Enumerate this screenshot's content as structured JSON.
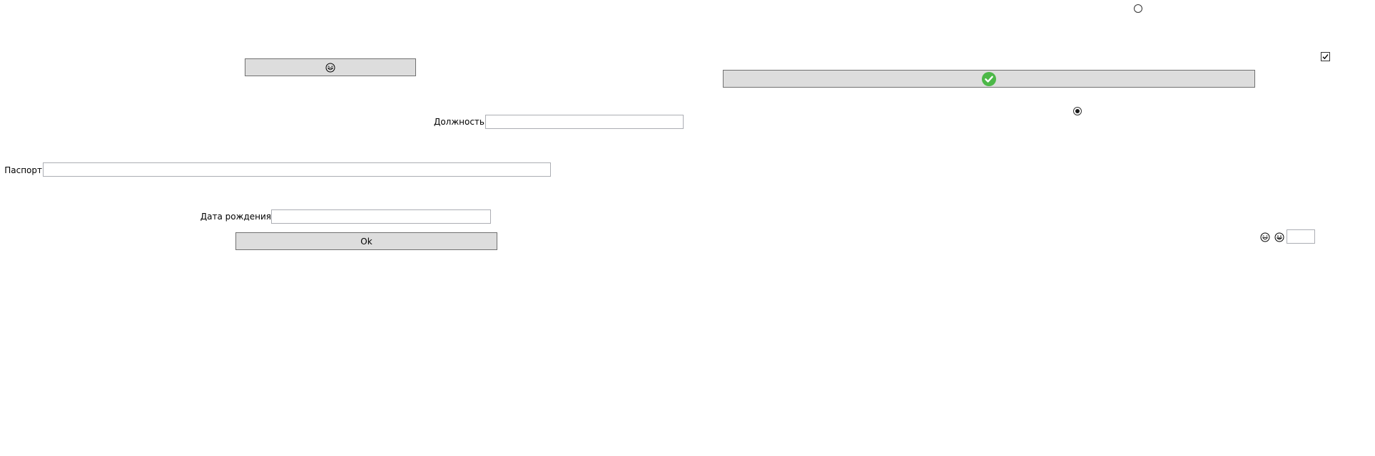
{
  "form": {
    "position_label": "Должность",
    "position_value": "",
    "passport_label": "Паспорт",
    "passport_value": "",
    "birthdate_label": "Дата рождения",
    "birthdate_value": "",
    "ok_label": "Ok",
    "small_input_value": ""
  },
  "controls": {
    "top_radio_checked": false,
    "middle_radio_checked": true,
    "checkbox_checked": true
  },
  "icons": {
    "emoji_button_icon": "laughing-face-icon",
    "confirm_button_icon": "green-check-circle-icon",
    "small_face_1": "laughing-face-icon",
    "small_face_2": "grinning-face-icon"
  },
  "colors": {
    "button_bg": "#dddddd",
    "button_border": "#707070",
    "input_border": "#abadb3",
    "check_green": "#4cb848"
  }
}
